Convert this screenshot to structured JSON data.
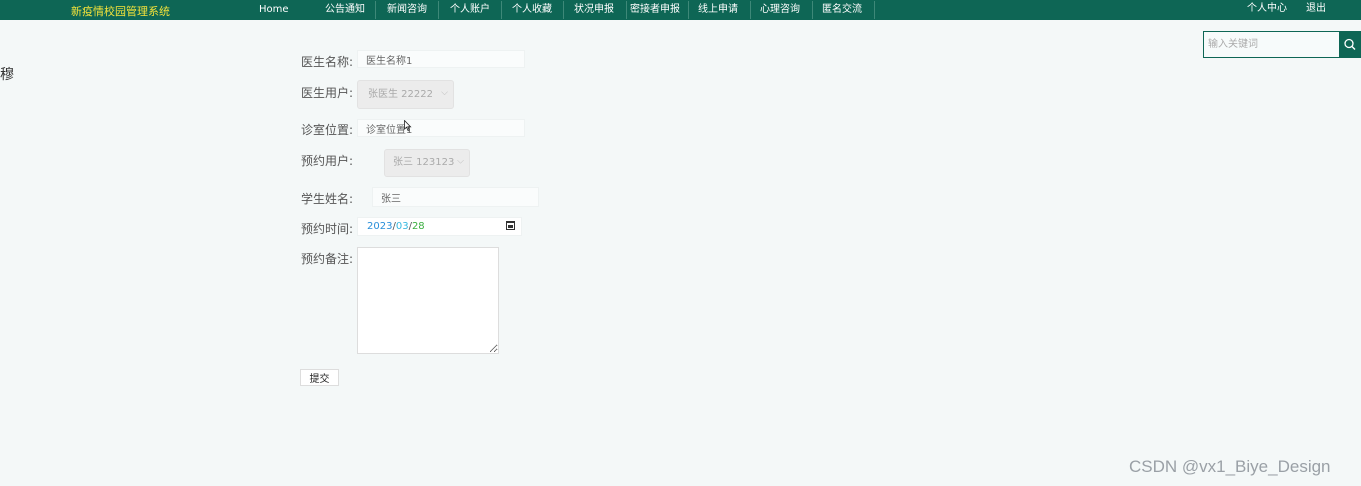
{
  "header": {
    "brand": "新疫情校园管理系统",
    "nav": [
      "Home",
      "公告通知",
      "新闻咨询",
      "个人账户",
      "个人收藏",
      "状况申报",
      "密接者申报",
      "线上申请",
      "心理咨询",
      "匿名交流"
    ],
    "user_center": "个人中心",
    "logout": "退出"
  },
  "search": {
    "placeholder": "输入关键词",
    "icon": "search-icon"
  },
  "side_glyph": "穆",
  "form": {
    "doctor_name": {
      "label": "医生名称:",
      "value": "医生名称1"
    },
    "doctor_user": {
      "label": "医生用户:",
      "value": "张医生 22222"
    },
    "room": {
      "label": "诊室位置:",
      "value": "诊室位置1"
    },
    "appoint_user": {
      "label": "预约用户:",
      "value": "张三 123123"
    },
    "student_name": {
      "label": "学生姓名:",
      "value": "张三"
    },
    "appoint_time": {
      "label": "预约时间:",
      "year": "2023",
      "month": "03",
      "day": "28"
    },
    "notes": {
      "label": "预约备注:",
      "value": ""
    },
    "submit": "提交"
  },
  "watermark": "CSDN @vx1_Biye_Design",
  "colors": {
    "topbar": "#0e6655",
    "brand": "#f2e23a",
    "page_bg": "#f4f8f8"
  }
}
